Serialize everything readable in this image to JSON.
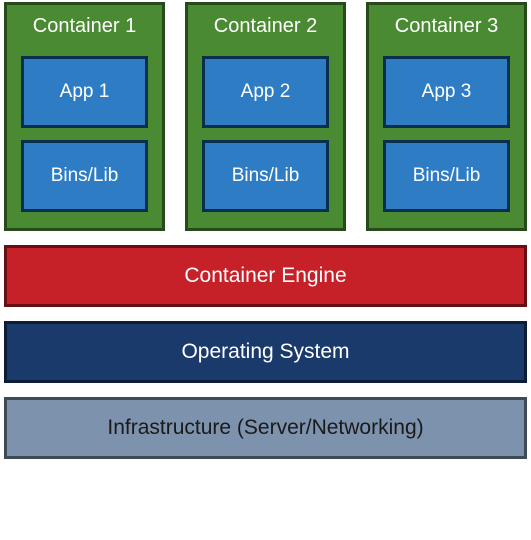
{
  "containers": [
    {
      "title": "Container 1",
      "app": "App 1",
      "libs": "Bins/Lib"
    },
    {
      "title": "Container 2",
      "app": "App 2",
      "libs": "Bins/Lib"
    },
    {
      "title": "Container 3",
      "app": "App 3",
      "libs": "Bins/Lib"
    }
  ],
  "layers": {
    "engine": "Container Engine",
    "os": "Operating System",
    "infra": "Infrastructure (Server/Networking)"
  }
}
